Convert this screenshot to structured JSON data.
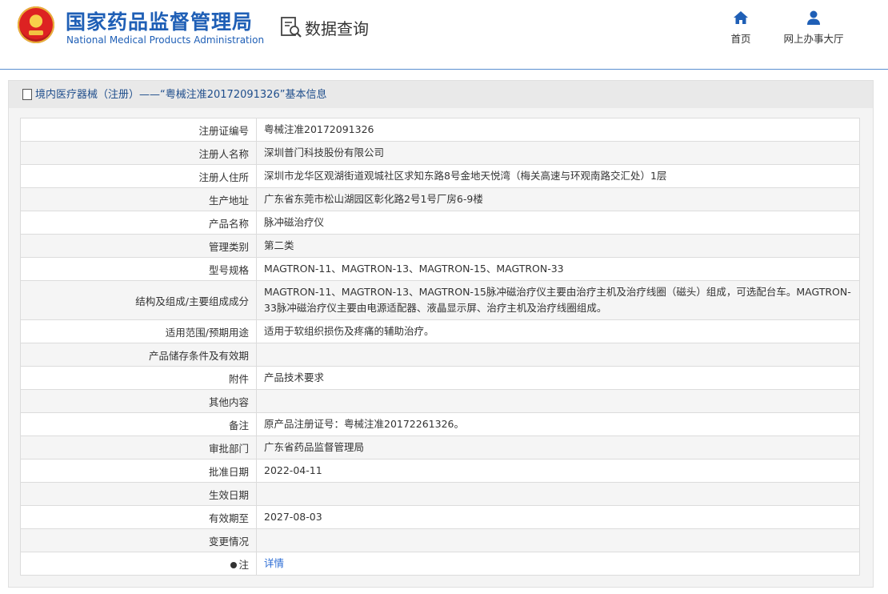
{
  "header": {
    "title_cn": "国家药品监督管理局",
    "title_en": "National Medical Products Administration",
    "query_label": "数据查询",
    "nav": [
      {
        "label": "首页",
        "icon": "home-icon"
      },
      {
        "label": "网上办事大厅",
        "icon": "user-icon"
      }
    ]
  },
  "panel": {
    "title": "境内医疗器械（注册）——“粤械注准20172091326”基本信息"
  },
  "table": {
    "rows": [
      {
        "key": "注册证编号",
        "value": "粤械注准20172091326"
      },
      {
        "key": "注册人名称",
        "value": "深圳普门科技股份有限公司"
      },
      {
        "key": "注册人住所",
        "value": "深圳市龙华区观湖街道观城社区求知东路8号金地天悦湾（梅关高速与环观南路交汇处）1层"
      },
      {
        "key": "生产地址",
        "value": "广东省东莞市松山湖园区彰化路2号1号厂房6-9楼"
      },
      {
        "key": "产品名称",
        "value": "脉冲磁治疗仪"
      },
      {
        "key": "管理类别",
        "value": "第二类"
      },
      {
        "key": "型号规格",
        "value": "MAGTRON-11、MAGTRON-13、MAGTRON-15、MAGTRON-33"
      },
      {
        "key": "结构及组成/主要组成成分",
        "value": "MAGTRON-11、MAGTRON-13、MAGTRON-15脉冲磁治疗仪主要由治疗主机及治疗线圈（磁头）组成，可选配台车。MAGTRON-33脉冲磁治疗仪主要由电源适配器、液晶显示屏、治疗主机及治疗线圈组成。"
      },
      {
        "key": "适用范围/预期用途",
        "value": "适用于软组织损伤及疼痛的辅助治疗。"
      },
      {
        "key": "产品储存条件及有效期",
        "value": ""
      },
      {
        "key": "附件",
        "value": "产品技术要求"
      },
      {
        "key": "其他内容",
        "value": ""
      },
      {
        "key": "备注",
        "value": "原产品注册证号：粤械注准20172261326。"
      },
      {
        "key": "审批部门",
        "value": "广东省药品监督管理局"
      },
      {
        "key": "批准日期",
        "value": "2022-04-11"
      },
      {
        "key": "生效日期",
        "value": ""
      },
      {
        "key": "有效期至",
        "value": "2027-08-03"
      },
      {
        "key": "变更情况",
        "value": ""
      }
    ],
    "note_row": {
      "key": "注",
      "value": "详情"
    }
  }
}
